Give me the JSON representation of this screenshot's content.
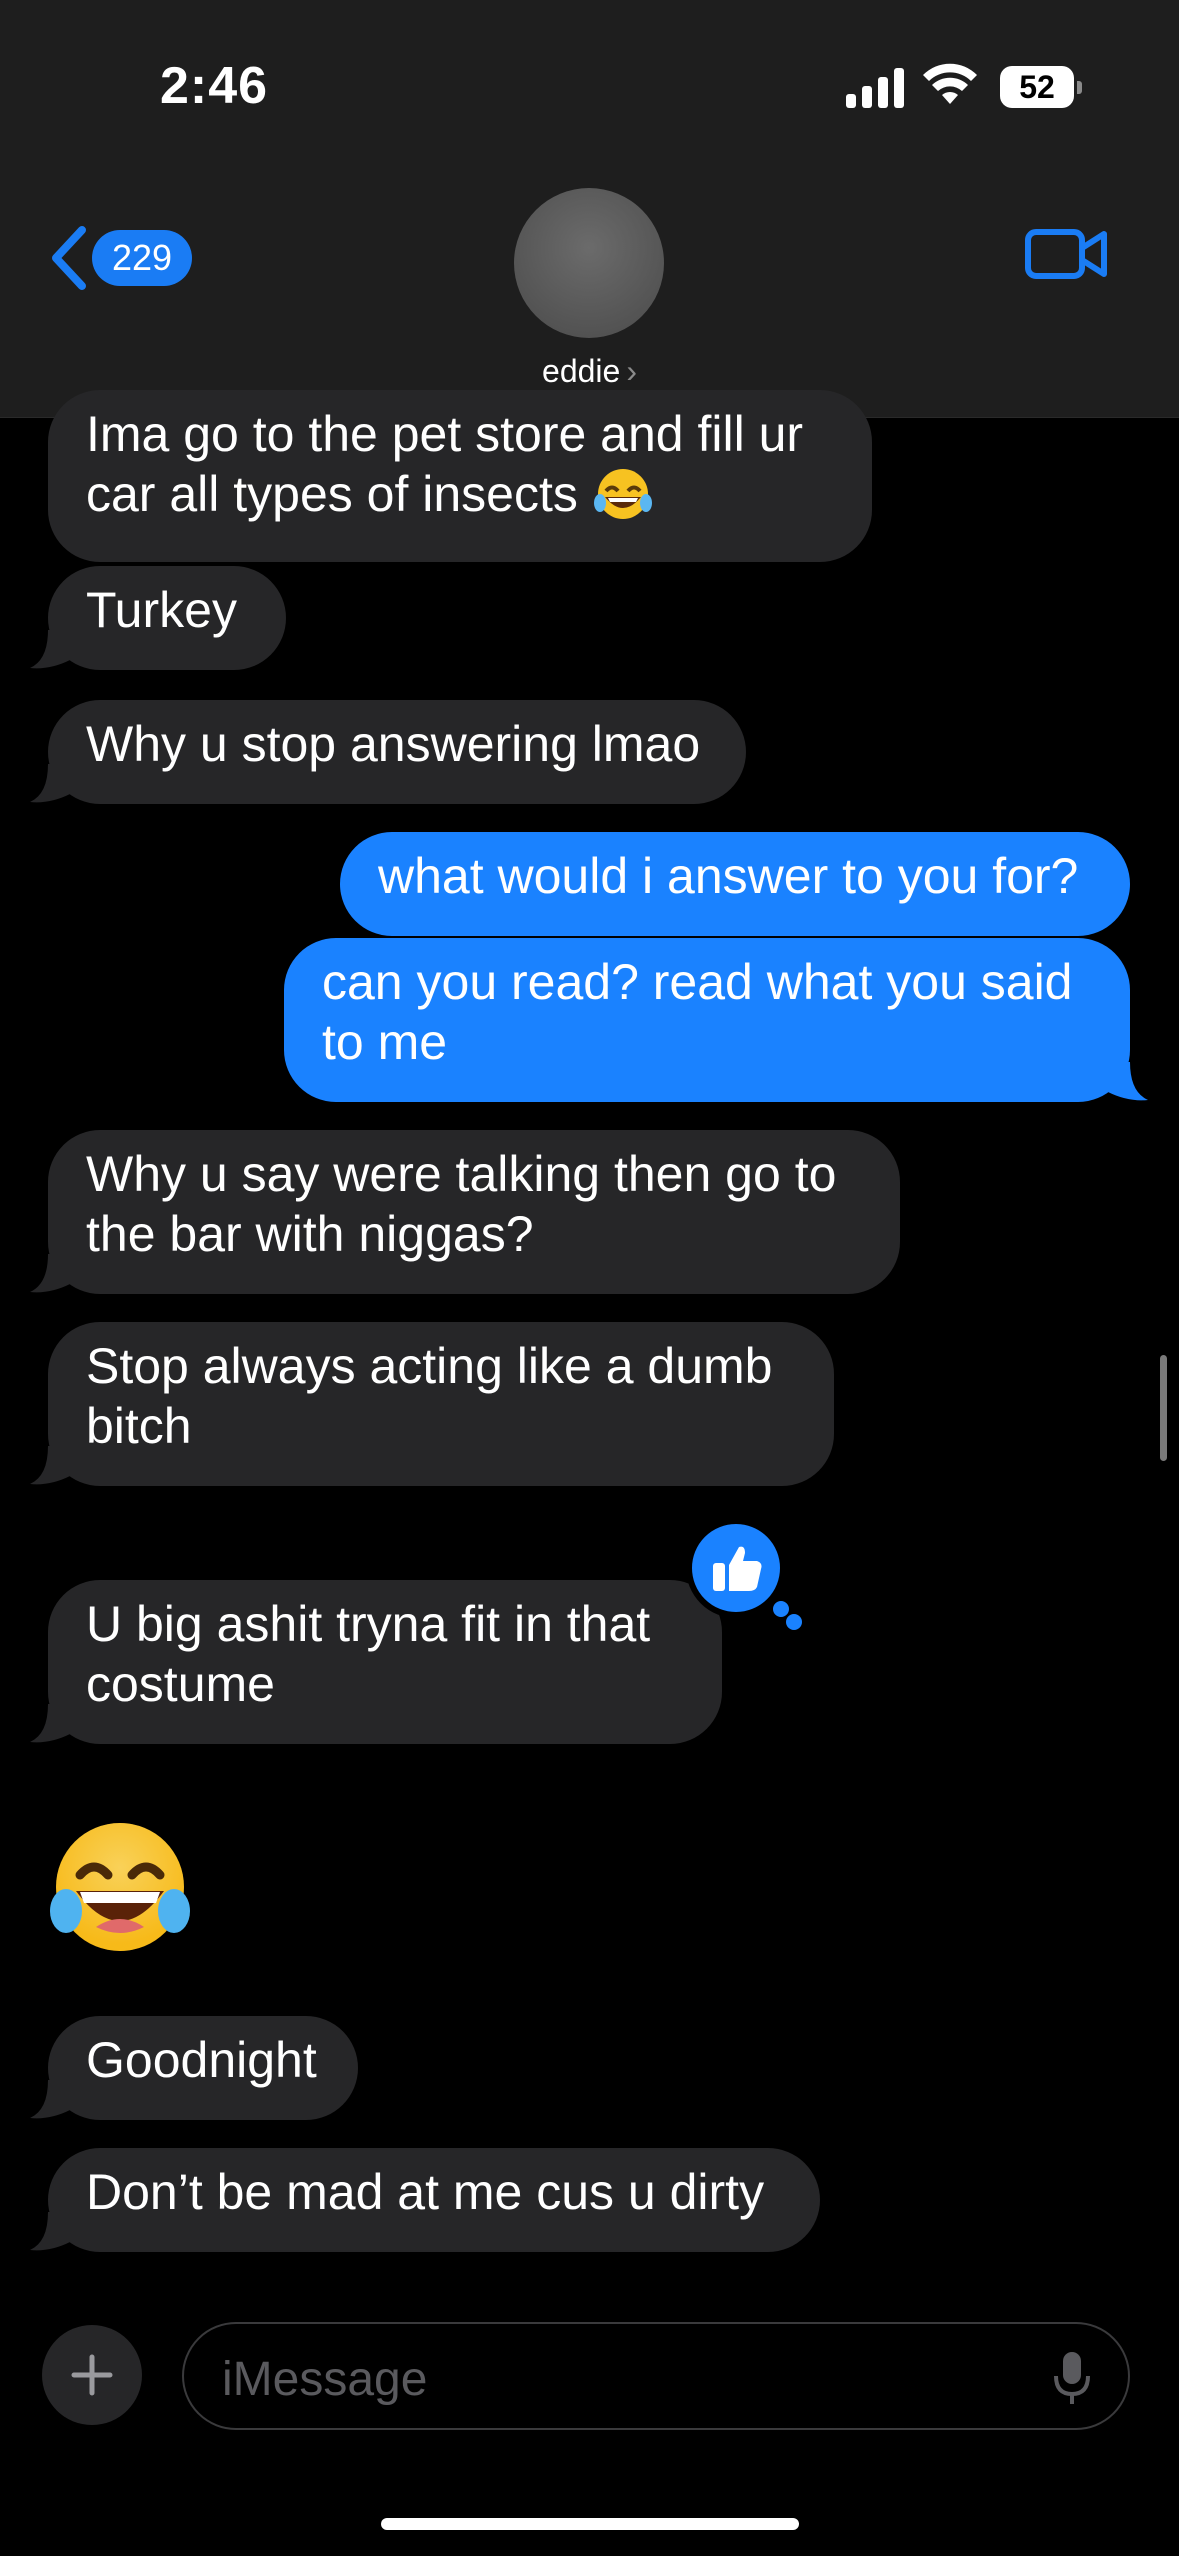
{
  "status_bar": {
    "time": "2:46",
    "battery": "52"
  },
  "header": {
    "unread_count": "229",
    "contact_name": "eddie",
    "contact_chevron": "›"
  },
  "messages": {
    "m1_line1": "Ima go to the pet store and fill ur",
    "m1_line2": "car all types of insects",
    "m2": "Turkey",
    "m3": "Why u stop answering lmao",
    "m4": "what would i answer to you for?",
    "m5_line1": "can you read? read what you said",
    "m5_line2": "to me",
    "m6_line1": "Why u say were talking then go to",
    "m6_line2": "the bar with niggas?",
    "m7_line1": "Stop always acting like a dumb",
    "m7_line2": "bitch",
    "m8_line1": "U big ashit tryna fit in that",
    "m8_line2": "costume",
    "m10": "Goodnight",
    "m11": "Don’t be mad at me cus u dirty"
  },
  "input": {
    "placeholder": "iMessage"
  },
  "colors": {
    "outgoing": "#1a82ff",
    "incoming": "#262628",
    "accent": "#1a7cf4"
  }
}
